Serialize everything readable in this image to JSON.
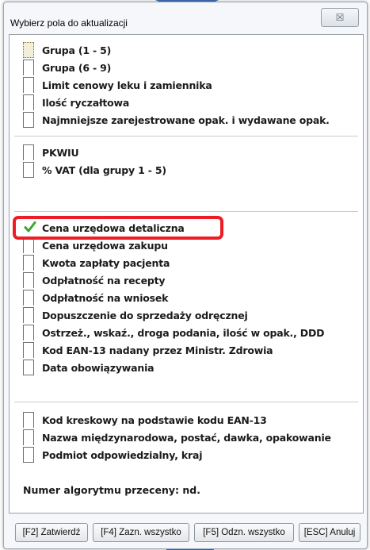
{
  "window": {
    "title": "Wybierz pola do aktualizacji",
    "close_glyph": "☒"
  },
  "groups": [
    {
      "items": [
        {
          "label": "Grupa (1 - 5)",
          "checked": false,
          "focused": true
        },
        {
          "label": "Grupa (6 - 9)",
          "checked": false
        },
        {
          "label": "Limit cenowy leku i zamiennika",
          "checked": false
        },
        {
          "label": "Ilość ryczałtowa",
          "checked": false
        },
        {
          "label": "Najmniejsze zarejestrowane opak. i wydawane opak.",
          "checked": false
        }
      ]
    },
    {
      "items": [
        {
          "label": "PKWIU",
          "checked": false
        },
        {
          "label": "% VAT (dla grupy 1 - 5)",
          "checked": false
        }
      ]
    },
    {
      "items": [
        {
          "label": "Cena urzędowa detaliczna",
          "checked": true,
          "highlighted": true
        },
        {
          "label": "Cena urzędowa zakupu",
          "checked": false
        },
        {
          "label": "Kwota zapłaty pacjenta",
          "checked": false
        },
        {
          "label": "Odpłatność na recepty",
          "checked": false
        },
        {
          "label": "Odpłatność na wniosek",
          "checked": false
        },
        {
          "label": "Dopuszczenie do sprzedaży odręcznej",
          "checked": false
        },
        {
          "label": "Ostrzeż., wskaź., droga podania, ilość w opak., DDD",
          "checked": false
        },
        {
          "label": "Kod EAN-13 nadany przez Ministr. Zdrowia",
          "checked": false
        },
        {
          "label": "Data obowiązywania",
          "checked": false
        }
      ]
    },
    {
      "items": [
        {
          "label": "Kod kreskowy na podstawie kodu EAN-13",
          "checked": false
        },
        {
          "label": "Nazwa międzynarodowa, postać, dawka, opakowanie",
          "checked": false
        },
        {
          "label": "Podmiot odpowiedzialny, kraj",
          "checked": false
        }
      ]
    }
  ],
  "algorithm_text": "Numer algorytmu przeceny: nd.",
  "buttons": {
    "confirm": "[F2] Zatwierdź",
    "select_all": "[F4] Zazn. wszystko",
    "deselect_all": "[F5] Odzn. wszystko",
    "cancel": "[ESC] Anuluj"
  },
  "colors": {
    "highlight_border": "#ee1c24",
    "check_mark": "#3aa832",
    "background_shape": "#3f6fb8"
  }
}
